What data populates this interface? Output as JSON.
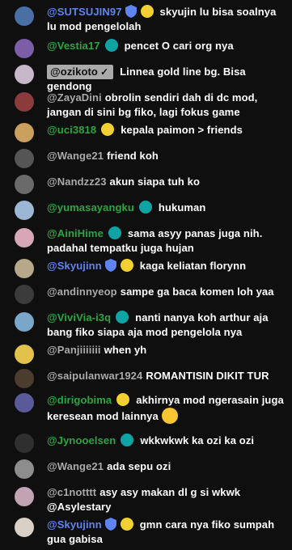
{
  "messages": [
    {
      "author": "@SUTSUJIN97",
      "author_style": "blue",
      "verified": true,
      "member": "yellow",
      "text": "skyujin lu bisa soalnya lu mod pengelolah"
    },
    {
      "author": "@Vestia17",
      "author_style": "green",
      "member": "teal",
      "text": "pencet O cari org nya"
    },
    {
      "author": "@ozikoto",
      "author_style": "boxed",
      "owner_check": "✓",
      "text": "Linnea gold line bg. Bisa gendong"
    },
    {
      "author": "@ZayaDini",
      "author_style": "grey",
      "text": "obrolin sendiri dah di dc mod, jangan di sini bg fiko, lagi fokus game"
    },
    {
      "author": "@uci3818",
      "author_style": "green",
      "member": "yellow",
      "text": "kepala paimon > friends"
    },
    {
      "author": "@Wange21",
      "author_style": "grey",
      "text": "friend koh"
    },
    {
      "author": "@Nandzz23",
      "author_style": "grey",
      "text": "akun siapa tuh ko"
    },
    {
      "author": "@yumasayangku",
      "author_style": "green",
      "member": "teal",
      "text": "hukuman"
    },
    {
      "author": "@AiniHime",
      "author_style": "green",
      "member": "teal",
      "text": "sama asyy panas juga nih. padahal tempatku juga hujan"
    },
    {
      "author": "@Skyujinn",
      "author_style": "blue",
      "verified": true,
      "member": "yellow",
      "text": "kaga keliatan florynn"
    },
    {
      "author": "@andinnyeop",
      "author_style": "grey",
      "text": "sampe ga baca komen loh yaa"
    },
    {
      "author": "@ViviVia-i3q",
      "author_style": "green",
      "member": "teal",
      "text": "nanti nanya koh arthur aja bang fiko siapa aja mod pengelola nya"
    },
    {
      "author": "@Panjiiiiiii",
      "author_style": "grey",
      "text": "when yh"
    },
    {
      "author": "@saipulanwar1924",
      "author_style": "grey",
      "text": "ROMANTISIN DIKIT TUR"
    },
    {
      "author": "@dirigobima",
      "author_style": "green",
      "member": "yellow",
      "text": "akhirnya mod ngerasain juga keresean mod lainnya",
      "emoji": "rofl-emoji"
    },
    {
      "author": "@Jynooelsen",
      "author_style": "green",
      "member": "teal",
      "text": "wkkwkwk ka ozi ka ozi"
    },
    {
      "author": "@Wange21",
      "author_style": "grey",
      "text": "ada sepu ozi"
    },
    {
      "author": "@c1notttt",
      "author_style": "grey",
      "text": "asy asy makan dl g si wkwk @Asylestary"
    },
    {
      "author": "@Skyujinn",
      "author_style": "blue",
      "verified": true,
      "member": "yellow",
      "text": "gmn cara nya fiko sumpah gua gabisa"
    }
  ],
  "colors": {
    "background": "#0f0f0f",
    "author_grey": "#aaaaaa",
    "author_green": "#2ba640",
    "author_blue": "#5e84f1",
    "member_yellow": "#f2d031",
    "member_teal": "#0fa3a3"
  }
}
